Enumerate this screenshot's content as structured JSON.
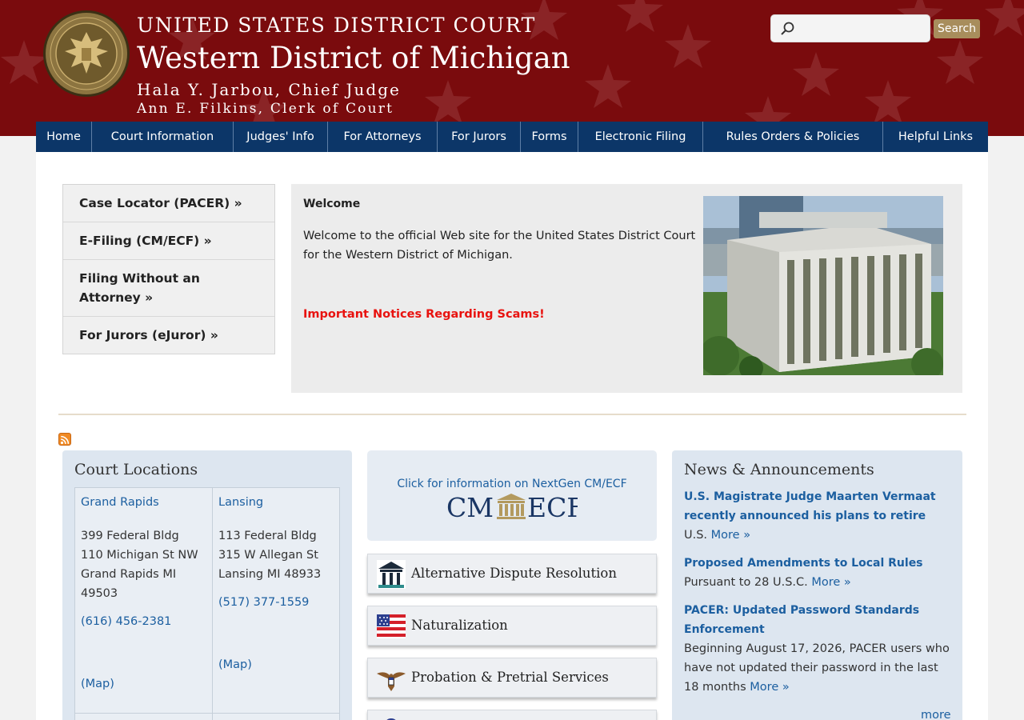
{
  "header": {
    "court_name": "UNITED STATES DISTRICT COURT",
    "district": "Western District of Michigan",
    "chief_judge": "Hala Y. Jarbou, Chief Judge",
    "clerk": "Ann E. Filkins, Clerk of Court",
    "seal_icon": "court-seal-icon",
    "colors": {
      "banner": "#7a0b0d",
      "nav": "#0c3668",
      "accent": "#a88d5c"
    }
  },
  "search": {
    "value": "",
    "placeholder": "",
    "button_label": "Search"
  },
  "nav": {
    "items": [
      "Home",
      "Court Information",
      "Judges' Info",
      "For Attorneys",
      "For Jurors",
      "Forms",
      "Electronic Filing",
      "Rules Orders & Policies",
      "Helpful Links"
    ]
  },
  "quick_links": [
    "Case Locator (PACER) »",
    "E-Filing (CM/ECF) »",
    "Filing Without an Attorney »",
    "For Jurors (eJuror) »"
  ],
  "welcome": {
    "title": "Welcome",
    "intro": "Welcome to the official Web site for the United States District Court for the Western District of Michigan.",
    "scam_notice": "Important Notices Regarding Scams!",
    "scam_color": "#e8120f"
  },
  "locations": {
    "title": "Court Locations",
    "offices": [
      {
        "city": "Grand Rapids",
        "address": [
          "399 Federal Bldg",
          "110 Michigan St NW",
          "Grand Rapids MI",
          "49503"
        ],
        "phone": "(616) 456-2381",
        "map": "(Map)"
      },
      {
        "city": "Lansing",
        "address": [
          "113 Federal Bldg",
          "315 W Allegan St",
          "Lansing MI 48933"
        ],
        "phone": "(517) 377-1559",
        "map": "(Map)"
      }
    ]
  },
  "cmecf": {
    "link": "Click for information on NextGen CM/ECF",
    "logo_left": "CM",
    "logo_right": "ECF"
  },
  "services": [
    {
      "label": "Alternative Dispute Resolution",
      "icon": "courthouse-icon"
    },
    {
      "label": "Naturalization",
      "icon": "us-flag-icon"
    },
    {
      "label": "Probation & Pretrial Services",
      "icon": "eagle-icon"
    }
  ],
  "news": {
    "title": "News & Announcements",
    "items": [
      {
        "title": "U.S. Magistrate Judge Maarten Vermaat recently announced his plans to retire",
        "body": "U.S.",
        "more": "More »"
      },
      {
        "title": "Proposed Amendments to Local Rules",
        "body": "Pursuant to 28 U.S.C.",
        "more": "More »"
      },
      {
        "title": "PACER: Updated Password Standards Enforcement",
        "body": "Beginning August 17, 2026, PACER users who have not updated their password in the last 18 months",
        "more": "More »"
      }
    ],
    "more_link": "more"
  }
}
